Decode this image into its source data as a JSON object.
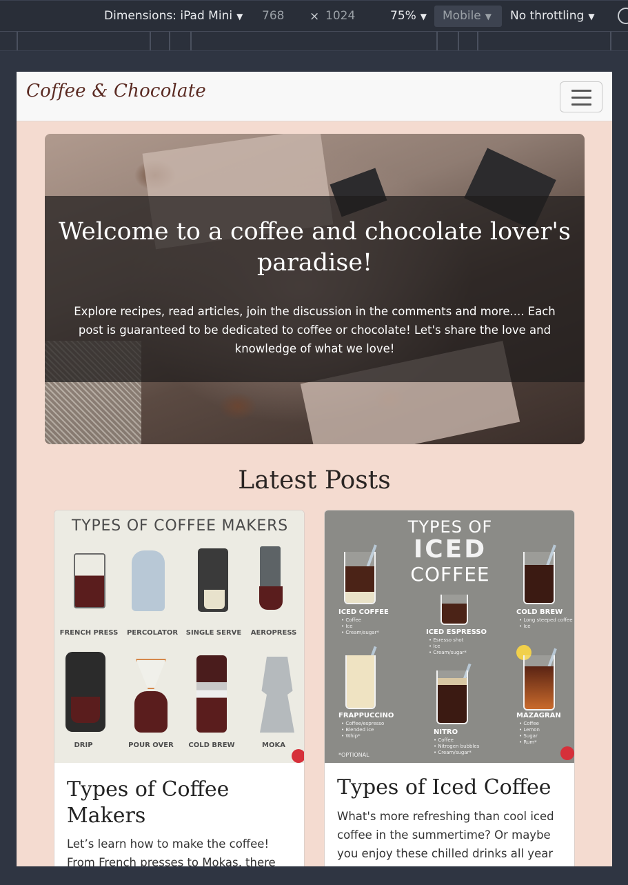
{
  "devtools": {
    "dimensions_label": "Dimensions: iPad Mini",
    "width_value": "768",
    "height_value": "1024",
    "times_symbol": "×",
    "zoom": "75%",
    "device_mode": "Mobile",
    "throttling": "No throttling"
  },
  "navbar": {
    "brand": "Coffee & Chocolate"
  },
  "hero": {
    "title": "Welcome to a coffee and chocolate lover's paradise!",
    "text": "Explore recipes, read articles, join the discussion in the comments and more.... Each post is guaranteed to be dedicated to coffee or chocolate! Let's share the love and knowledge of what we love!"
  },
  "latest": {
    "heading": "Latest Posts",
    "posts": [
      {
        "title": "Types of Coffee Makers",
        "excerpt": "Let’s learn how to make the coffee! From French presses to Mokas, there are",
        "image": {
          "heading": "TYPES OF COFFEE MAKERS",
          "items": [
            "FRENCH PRESS",
            "PERCOLATOR",
            "SINGLE SERVE",
            "AEROPRESS",
            "DRIP",
            "POUR OVER",
            "COLD BREW",
            "MOKA"
          ]
        }
      },
      {
        "title": "Types of Iced Coffee",
        "excerpt": "What's more refreshing than cool iced coffee in the summertime? Or maybe you enjoy these chilled drinks all year",
        "image": {
          "heading_line1": "TYPES OF",
          "heading_line2": "ICED",
          "heading_line3": "COFFEE",
          "items": [
            {
              "name": "ICED COFFEE",
              "notes": "• Coffee\n• Ice\n• Cream/sugar*"
            },
            {
              "name": "COLD BREW",
              "notes": "• Long steeped coffee\n• Ice"
            },
            {
              "name": "ICED ESPRESSO",
              "notes": "• Esresso shot\n• Ice\n• Cream/sugar*"
            },
            {
              "name": "FRAPPUCCINO",
              "notes": "• Coffee/espresso\n• Blended ice\n• Whip*"
            },
            {
              "name": "NITRO",
              "notes": "• Coffee\n• Nitrogen bubbles\n• Cream/sugar*"
            },
            {
              "name": "MAZAGRAN",
              "notes": "• Coffee\n• Lemon\n• Sugar\n• Rum*"
            }
          ],
          "footnote": "*OPTIONAL"
        }
      }
    ]
  }
}
